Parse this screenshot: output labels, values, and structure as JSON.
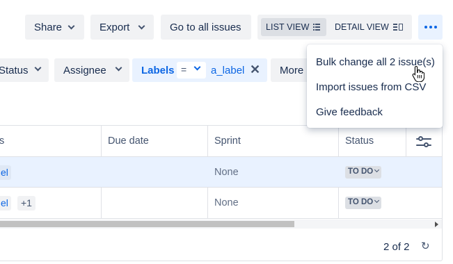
{
  "toolbar": {
    "share_label": "Share",
    "export_label": "Export",
    "goto_label": "Go to all issues",
    "list_view_label": "LIST VIEW",
    "detail_view_label": "DETAIL VIEW"
  },
  "filters": {
    "status_label": "Status",
    "assignee_label": "Assignee",
    "labels_field": "Labels",
    "labels_operator": "=",
    "labels_value": "a_label",
    "labels_clear": "✕",
    "more_label": "More"
  },
  "menu": {
    "items": [
      {
        "label": "Bulk change all 2 issue(s)"
      },
      {
        "label": "Import issues from CSV"
      },
      {
        "label": "Give feedback"
      }
    ]
  },
  "table": {
    "columns": [
      "s",
      "Due date",
      "Sprint",
      "Status"
    ],
    "rows": [
      {
        "labels_fragment": "el",
        "extra_count": "",
        "due_date": "",
        "sprint": "None",
        "status": "TO DO"
      },
      {
        "labels_fragment": "el",
        "extra_count": "+1",
        "due_date": "",
        "sprint": "None",
        "status": "TO DO"
      }
    ]
  },
  "pagination": {
    "text": "2 of 2"
  },
  "colors": {
    "accent": "#0c66e4",
    "selected_row": "#e9f2ff",
    "button_bg": "#f1f2f4"
  },
  "icons": {
    "list": "list-icon",
    "detail": "detail-icon",
    "more": "more-dots-icon",
    "settings": "column-settings-icon",
    "refresh": "refresh-icon"
  }
}
